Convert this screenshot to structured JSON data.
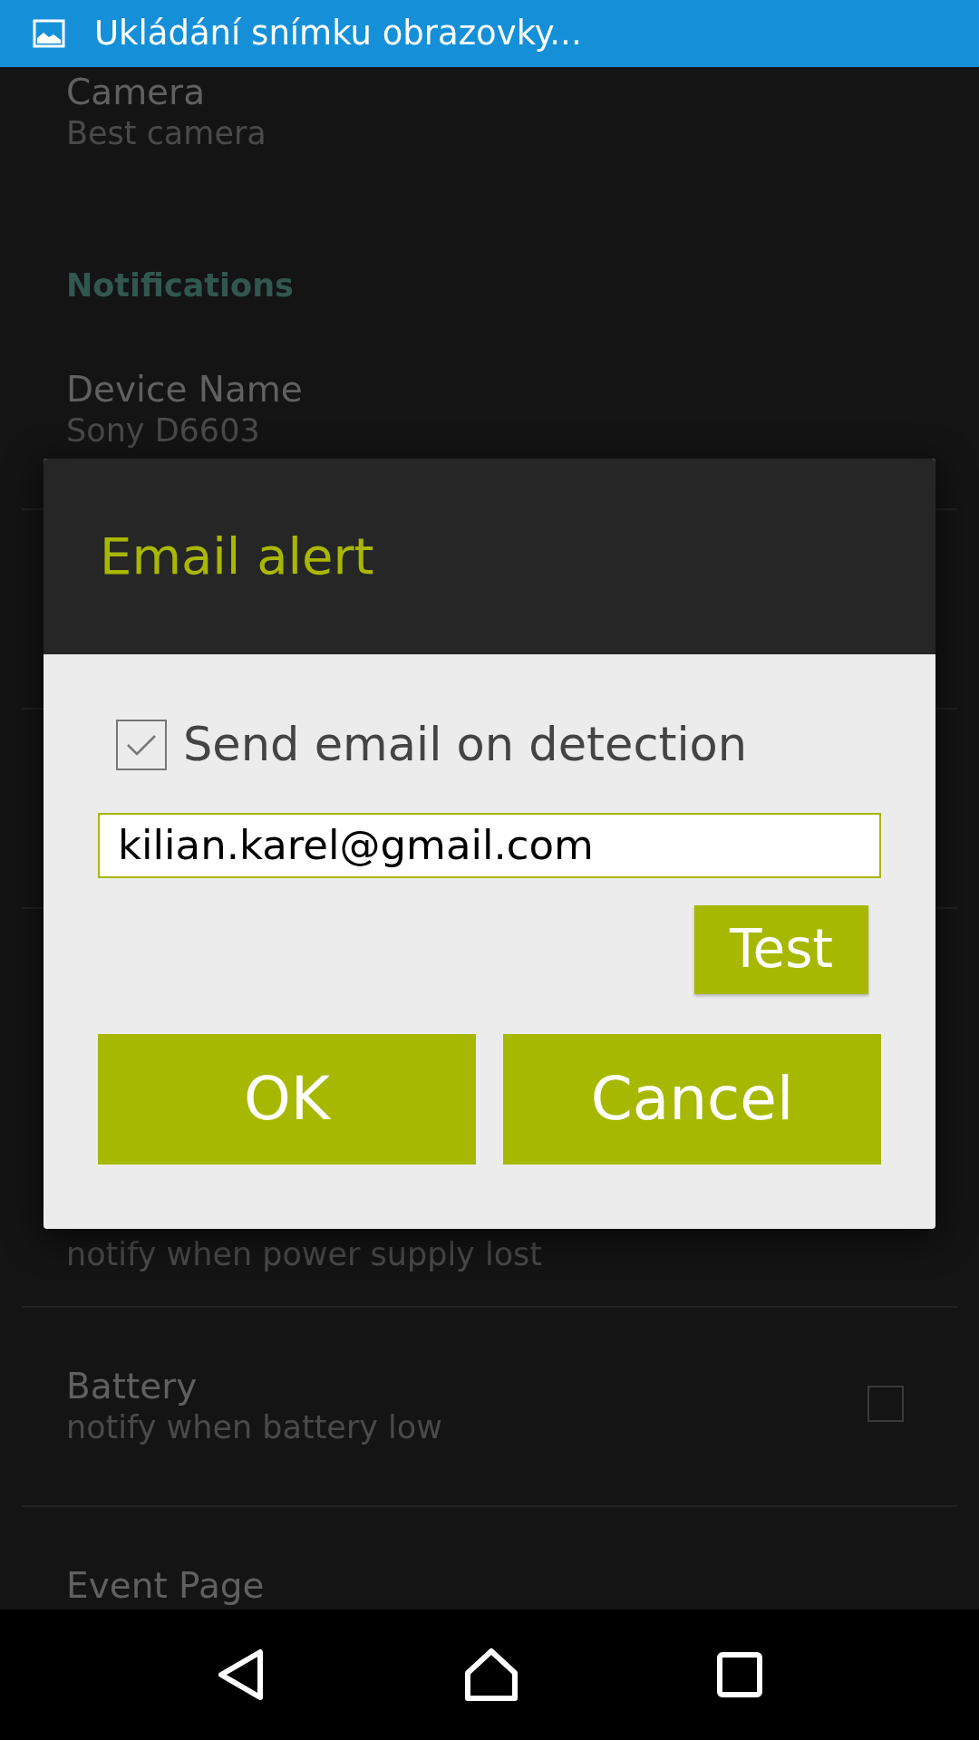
{
  "status_bar": {
    "text": "Ukládání snímku obrazovky..."
  },
  "settings": [
    {
      "kind": "item",
      "title": "Camera",
      "subtitle": "Best camera"
    },
    {
      "kind": "header",
      "title": "Notifications"
    },
    {
      "kind": "item",
      "title": "Device Name",
      "subtitle": "Sony D6603"
    },
    {
      "kind": "item",
      "subtitle": "notify when power supply lost"
    },
    {
      "kind": "item",
      "title": "Battery",
      "subtitle": "notify when battery low",
      "checked": false
    },
    {
      "kind": "item",
      "title": "Event Page"
    }
  ],
  "dialog": {
    "title": "Email alert",
    "checkbox": {
      "label": "Send email on detection",
      "checked": true
    },
    "email_field": {
      "value": "kilian.karel@gmail.com"
    },
    "test_button": "Test",
    "buttons": [
      "OK",
      "Cancel"
    ]
  }
}
